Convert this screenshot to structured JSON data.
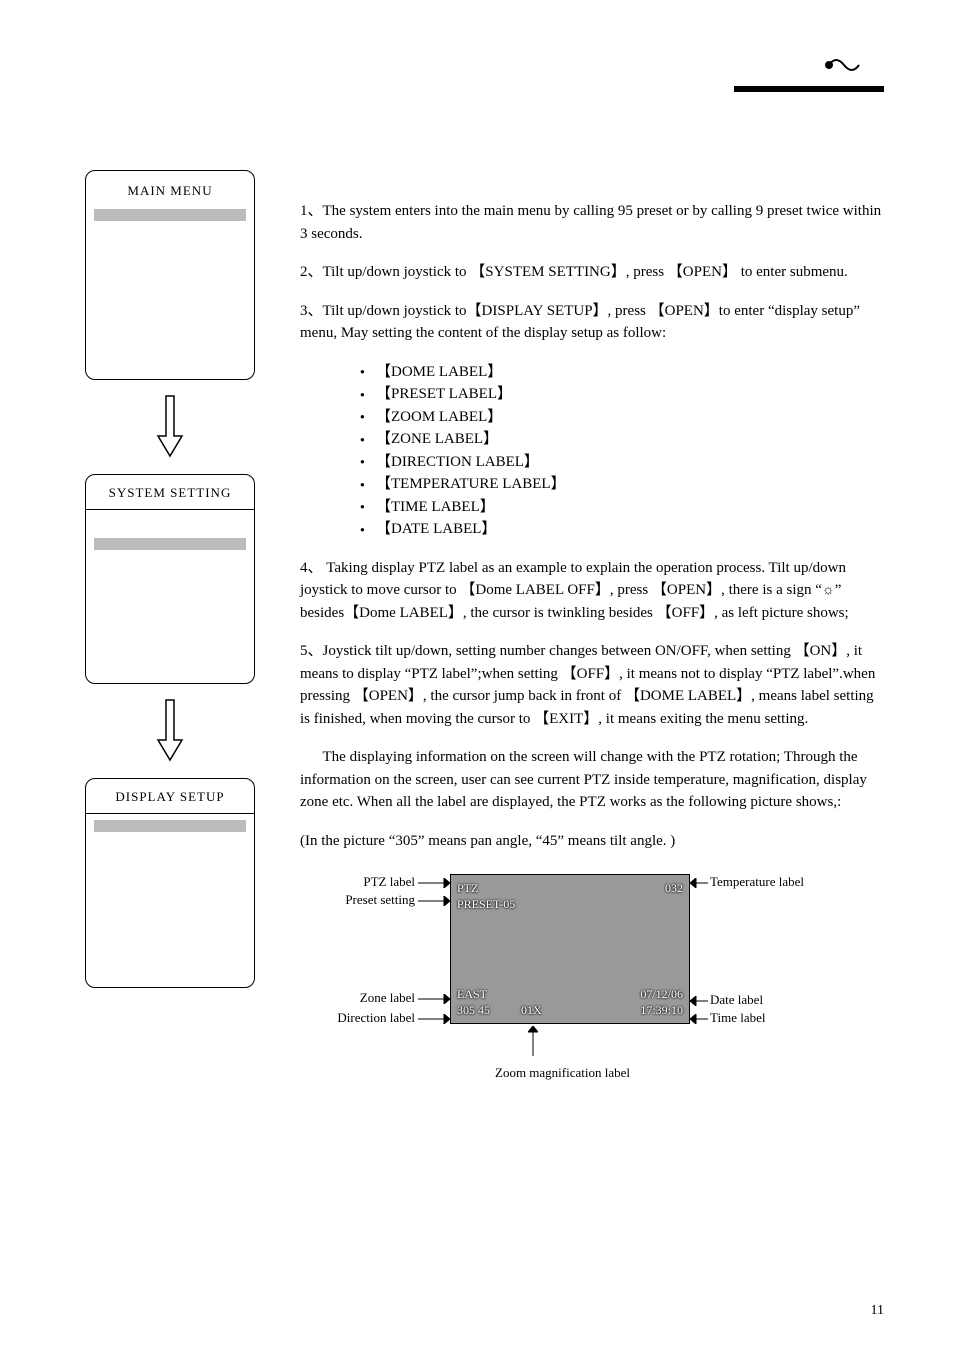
{
  "page_number": "11",
  "left": {
    "box1_title": "MAIN  MENU",
    "box2_title": "SYSTEM  SETTING",
    "box3_title": "DISPLAY  SETUP"
  },
  "para1": "1、The system enters into the main menu by calling 95 preset or by calling  9 preset twice within 3 seconds.",
  "para2": "2、Tilt up/down joystick to 【SYSTEM SETTING】, press 【OPEN】 to enter submenu.",
  "para3": "3、Tilt up/down joystick to【DISPLAY SETUP】,  press 【OPEN】to enter “display setup” menu, May setting the content of the display setup as follow:",
  "labels": [
    "【DOME  LABEL】",
    "【PRESET  LABEL】",
    "【ZOOM  LABEL】",
    "【ZONE  LABEL】",
    "【DIRECTION  LABEL】",
    "【TEMPERATURE  LABEL】",
    "【TIME  LABEL】",
    "【DATE  LABEL】"
  ],
  "para4_a": "4、 Taking display PTZ label as an example to explain the operation process. Tilt up/down joystick to move cursor to 【Dome LABEL    OFF】, press 【OPEN】, there is a sign “",
  "para4_sun": "☼",
  "para4_b": "” besides【Dome LABEL】, the cursor is twinkling besides 【OFF】, as left picture shows;",
  "para5": "5、Joystick tilt up/down, setting number changes between ON/OFF, when setting 【ON】, it means to display “PTZ label”;when setting 【OFF】, it means not to display “PTZ label”.when pressing 【OPEN】, the cursor jump back in front of 【DOME LABEL】, means label setting is finished, when moving the cursor to  【EXIT】, it means exiting the menu setting.",
  "para6": "      The displaying information on the screen will change with the PTZ rotation; Through the information on the screen, user can see current PTZ inside temperature, magnification, display zone etc. When all the label are displayed, the PTZ works as the following picture shows,:",
  "para7": "(In the picture “305” means pan angle, “45” means tilt angle. )",
  "annot": {
    "ptz_label": "PTZ label",
    "preset_setting": "Preset setting",
    "zone_label": "Zone label",
    "direction_label": "Direction label",
    "temperature_label": "Temperature label",
    "date_label": "Date label",
    "time_label": "Time label",
    "zoom_caption": "Zoom magnification label",
    "ov_ptz": "PTZ",
    "ov_temp": "032",
    "ov_preset": "PRESET-05",
    "ov_zone": "EAST",
    "ov_dir": "305 45",
    "ov_zoom": "01X",
    "ov_date": "07/12/06",
    "ov_time": "17:39:10"
  }
}
